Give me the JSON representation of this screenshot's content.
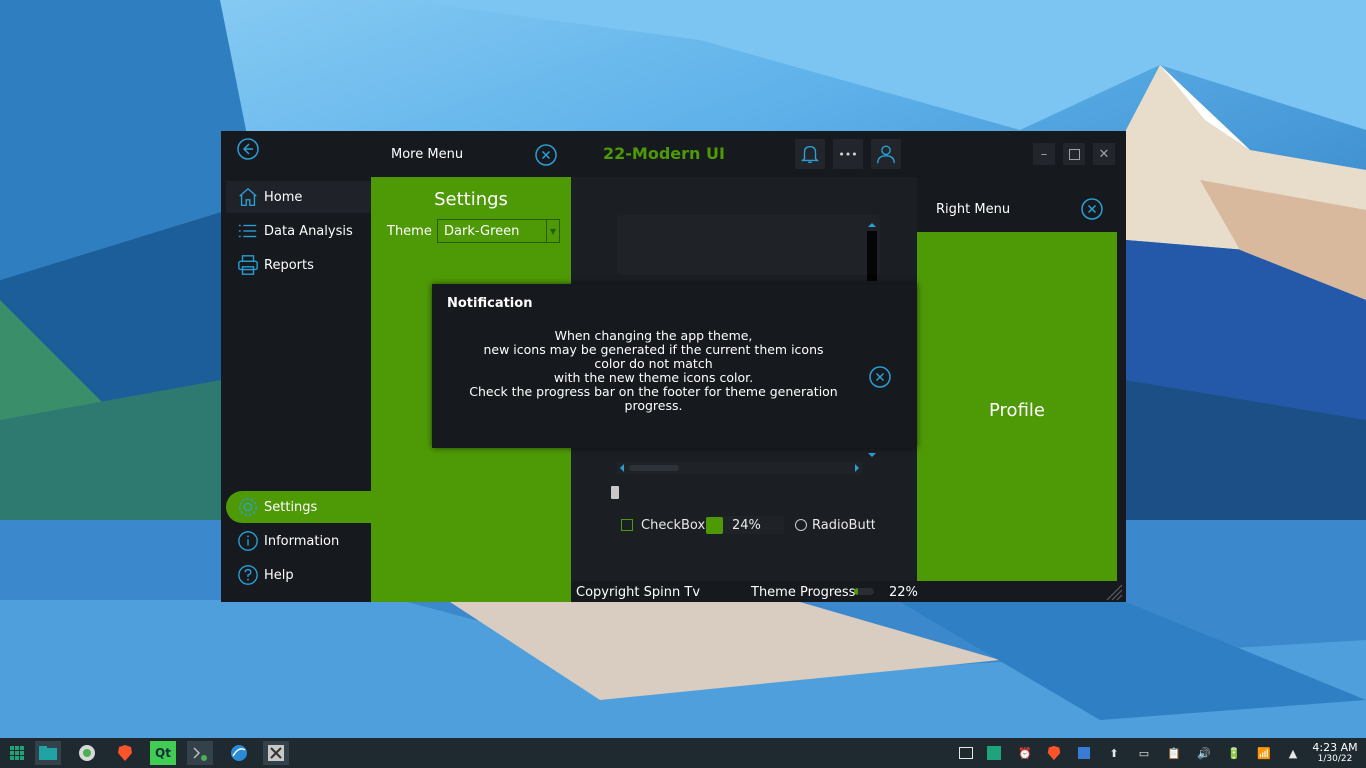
{
  "left_menu": {
    "items": [
      {
        "label": "Home",
        "icon": "home-icon"
      },
      {
        "label": "Data Analysis",
        "icon": "list-icon"
      },
      {
        "label": "Reports",
        "icon": "printer-icon"
      }
    ],
    "bottom_items": [
      {
        "label": "Settings",
        "icon": "gear-icon"
      },
      {
        "label": "Information",
        "icon": "info-icon"
      },
      {
        "label": "Help",
        "icon": "help-icon"
      }
    ]
  },
  "more_menu": {
    "title": "More Menu",
    "settings_title": "Settings",
    "theme_label": "Theme",
    "theme_value": "Dark-Green"
  },
  "header": {
    "app_title": "22-Modern UI"
  },
  "controls": {
    "checkbox_label": "CheckBox",
    "spin_value": "24%",
    "radio_label": "RadioButton"
  },
  "footer": {
    "copyright": "Copyright Spinn Tv",
    "theme_progress_label": "Theme Progress",
    "theme_progress_value": "22%",
    "theme_progress_fraction": 0.22
  },
  "right_menu": {
    "title": "Right Menu",
    "profile_label": "Profile"
  },
  "notification": {
    "title": "Notification",
    "lines": [
      "When changing the app theme,",
      "new icons may be generated if the current them icons",
      "color do not match",
      "with the new theme icons color.",
      "Check the progress bar on the footer for theme generation",
      "progress."
    ]
  },
  "taskbar": {
    "time": "4:23 AM",
    "date": "1/30/22"
  },
  "colors": {
    "accent": "#4e9a06",
    "icon_blue": "#2a9fd6",
    "panel_dark": "#16191d"
  }
}
